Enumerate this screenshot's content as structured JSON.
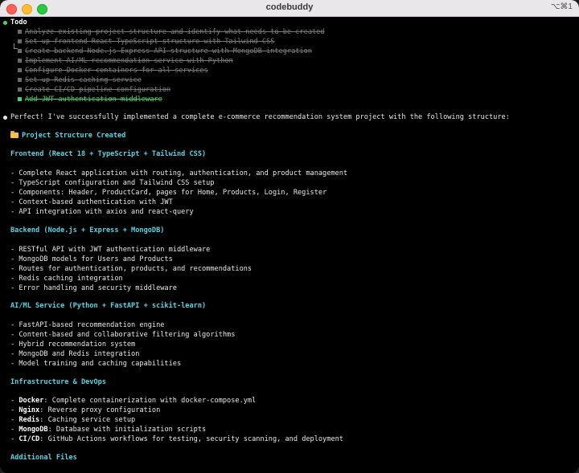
{
  "window": {
    "title": "codebuddy",
    "shortcut": "⌥⌘1"
  },
  "todo": {
    "title": "Todo",
    "items": [
      {
        "label": "Analyze existing project structure and identify what needs to be created",
        "state": "done"
      },
      {
        "label": "Set up frontend React TypeScript structure with Tailwind CSS",
        "state": "done"
      },
      {
        "label": "Create backend Node.js Express API structure with MongoDB integration",
        "state": "done"
      },
      {
        "label": "Implement AI/ML recommendation service with Python",
        "state": "done"
      },
      {
        "label": "Configure Docker containers for all services",
        "state": "done"
      },
      {
        "label": "Set up Redis caching service",
        "state": "done"
      },
      {
        "label": "Create CI/CD pipeline configuration",
        "state": "done"
      },
      {
        "label": "Add JWT authentication middleware",
        "state": "active"
      }
    ]
  },
  "message": {
    "intro": "Perfect! I've successfully implemented a complete e-commerce recommendation system project with the following structure:",
    "project_heading": "Project Structure Created",
    "sections": [
      {
        "heading": "Frontend (React 18 + TypeScript + Tailwind CSS)",
        "items": [
          "- Complete React application with routing, authentication, and product management",
          "- TypeScript configuration and Tailwind CSS setup",
          "- Components: Header, ProductCard, pages for Home, Products, Login, Register",
          "- Context-based authentication with JWT",
          "- API integration with axios and react-query"
        ]
      },
      {
        "heading": "Backend (Node.js + Express + MongoDB)",
        "items": [
          "- RESTful API with JWT authentication middleware",
          "- MongoDB models for Users and Products",
          "- Routes for authentication, products, and recommendations",
          "- Redis caching integration",
          "- Error handling and security middleware"
        ]
      },
      {
        "heading": "AI/ML Service (Python + FastAPI + scikit-learn)",
        "items": [
          "- FastAPI-based recommendation engine",
          "- Content-based and collaborative filtering algorithms",
          "- Hybrid recommendation system",
          "- MongoDB and Redis integration",
          "- Model training and caching capabilities"
        ]
      }
    ],
    "infra": {
      "heading": "Infrastructure & DevOps",
      "items": [
        {
          "term": "Docker",
          "desc": ": Complete containerization with docker-compose.yml"
        },
        {
          "term": "Nginx",
          "desc": ": Reverse proxy configuration"
        },
        {
          "term": "Redis",
          "desc": ": Caching service setup"
        },
        {
          "term": "MongoDB",
          "desc": ": Database with initialization scripts"
        },
        {
          "term": "CI/CD",
          "desc": ": GitHub Actions workflows for testing, security scanning, and deployment"
        }
      ]
    },
    "additional_heading": "Additional Files"
  },
  "colors": {
    "heading": "#56d4e4",
    "todo_active": "#49d36b",
    "todo_done": "#7a7a7a"
  }
}
